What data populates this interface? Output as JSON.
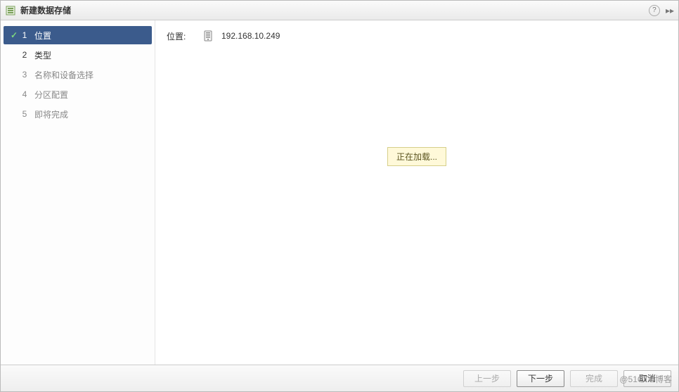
{
  "dialog": {
    "title": "新建数据存储"
  },
  "sidebar": {
    "steps": [
      {
        "num": "1",
        "label": "位置",
        "state": "active"
      },
      {
        "num": "2",
        "label": "类型",
        "state": "enabled"
      },
      {
        "num": "3",
        "label": "名称和设备选择",
        "state": "disabled"
      },
      {
        "num": "4",
        "label": "分区配置",
        "state": "disabled"
      },
      {
        "num": "5",
        "label": "即将完成",
        "state": "disabled"
      }
    ]
  },
  "content": {
    "location_label": "位置:",
    "location_value": "192.168.10.249",
    "loading_text": "正在加载..."
  },
  "footer": {
    "back": "上一步",
    "next": "下一步",
    "finish": "完成",
    "cancel": "取消"
  },
  "watermark": "@51CTO博客"
}
